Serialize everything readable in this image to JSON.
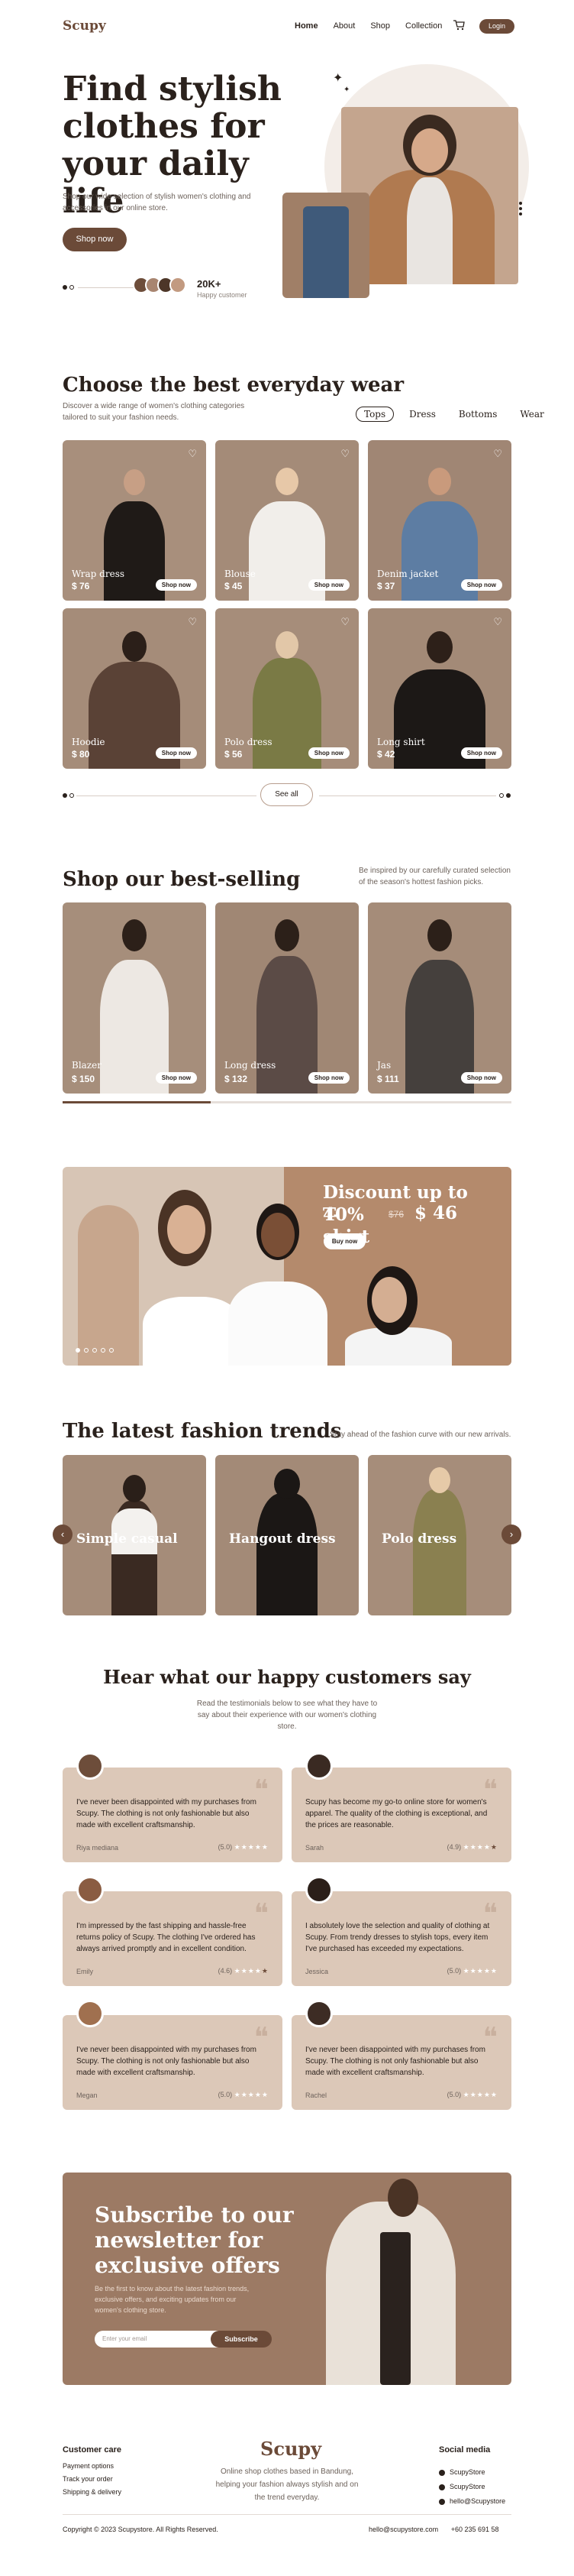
{
  "nav": {
    "logo": "Scupy",
    "links": [
      "Home",
      "About",
      "Shop",
      "Collection"
    ],
    "login": "Login"
  },
  "hero": {
    "title": "Find stylish clothes for your daily life",
    "subtitle": "Shop our wide selection of stylish women's clothing and accessories in our online store.",
    "cta": "Shop now",
    "count": "20K+",
    "count_label": "Happy customer"
  },
  "everyday": {
    "title": "Choose the best everyday wear",
    "subtitle": "Discover a wide range of women's clothing categories tailored to suit your fashion needs.",
    "tabs": [
      "Tops",
      "Dress",
      "Bottoms",
      "Wear"
    ],
    "products": [
      {
        "name": "Wrap dress",
        "price": "$ 76",
        "shop": "Shop now"
      },
      {
        "name": "Blouse",
        "price": "$ 45",
        "shop": "Shop now"
      },
      {
        "name": "Denim jacket",
        "price": "$ 37",
        "shop": "Shop now"
      },
      {
        "name": "Hoodie",
        "price": "$ 80",
        "shop": "Shop now"
      },
      {
        "name": "Polo dress",
        "price": "$ 56",
        "shop": "Shop now"
      },
      {
        "name": "Long shirt",
        "price": "$ 42",
        "shop": "Shop now"
      }
    ],
    "see_all": "See all"
  },
  "bestselling": {
    "title": "Shop our best-selling",
    "subtitle": "Be inspired by our carefully curated selection of the season's hottest fashion picks.",
    "products": [
      {
        "name": "Blazer",
        "price": "$ 150",
        "shop": "Shop now"
      },
      {
        "name": "Long dress",
        "price": "$ 132",
        "shop": "Shop now"
      },
      {
        "name": "Jas",
        "price": "$ 111",
        "shop": "Shop now"
      }
    ],
    "progress": 0.33
  },
  "discount": {
    "title": "Discount up to 40%",
    "product": "T-shirt",
    "old_price": "$76",
    "new_price": "$ 46",
    "cta": "Buy now"
  },
  "trends": {
    "title": "The latest fashion trends",
    "subtitle": "Stay ahead of the fashion curve with our new arrivals.",
    "items": [
      "Simple casual",
      "Hangout dress",
      "Polo dress"
    ]
  },
  "testimonials": {
    "title": "Hear what our happy customers say",
    "subtitle": "Read the testimonials below to see what they have to say about their experience with our women's clothing store.",
    "items": [
      {
        "text": "I've never been disappointed with my purchases from Scupy. The clothing is not only fashionable but also made with excellent craftsmanship.",
        "name": "Riya mediana",
        "rating": "(5.0)"
      },
      {
        "text": "Scupy has become my go-to online store for women's apparel. The quality of the clothing is exceptional, and the prices are reasonable.",
        "name": "Sarah",
        "rating": "(4.9)"
      },
      {
        "text": "I'm impressed by the fast shipping and hassle-free returns policy of Scupy. The clothing I've ordered has always arrived promptly and in excellent condition.",
        "name": "Emily",
        "rating": "(4.6)"
      },
      {
        "text": "I absolutely love the selection and quality of clothing at Scupy. From trendy dresses to stylish tops, every item I've purchased has exceeded my expectations.",
        "name": "Jessica",
        "rating": "(5.0)"
      },
      {
        "text": "I've never been disappointed with my purchases from Scupy. The clothing is not only fashionable but also made with excellent craftsmanship.",
        "name": "Megan",
        "rating": "(5.0)"
      },
      {
        "text": "I've never been disappointed with my purchases from Scupy. The clothing is not only fashionable but also made with excellent craftsmanship.",
        "name": "Rachel",
        "rating": "(5.0)"
      }
    ]
  },
  "subscribe": {
    "title": "Subscribe to our newsletter for exclusive offers",
    "text": "Be the first to know about the latest fashion trends, exclusive offers, and exciting updates from our women's clothing store.",
    "placeholder": "Enter your email",
    "cta": "Subscribe"
  },
  "footer": {
    "care_title": "Customer care",
    "care_links": [
      "Payment options",
      "Track your order",
      "Shipping & delivery"
    ],
    "logo": "Scupy",
    "desc": "Online shop clothes based in Bandung, helping your fashion always stylish and on the trend everyday.",
    "social_title": "Social media",
    "social_links": [
      "ScupyStore",
      "ScupyStore",
      "hello@Scupystore"
    ],
    "copyright": "Copyright © 2023 Scupystore. All Rights Reserved.",
    "email": "hello@scupystore.com",
    "phone": "+60 235 691 58"
  },
  "colors": {
    "accent": "#6b4a38",
    "card_bg": "#a38a77",
    "testimonial_bg": "#dcc8b8"
  }
}
